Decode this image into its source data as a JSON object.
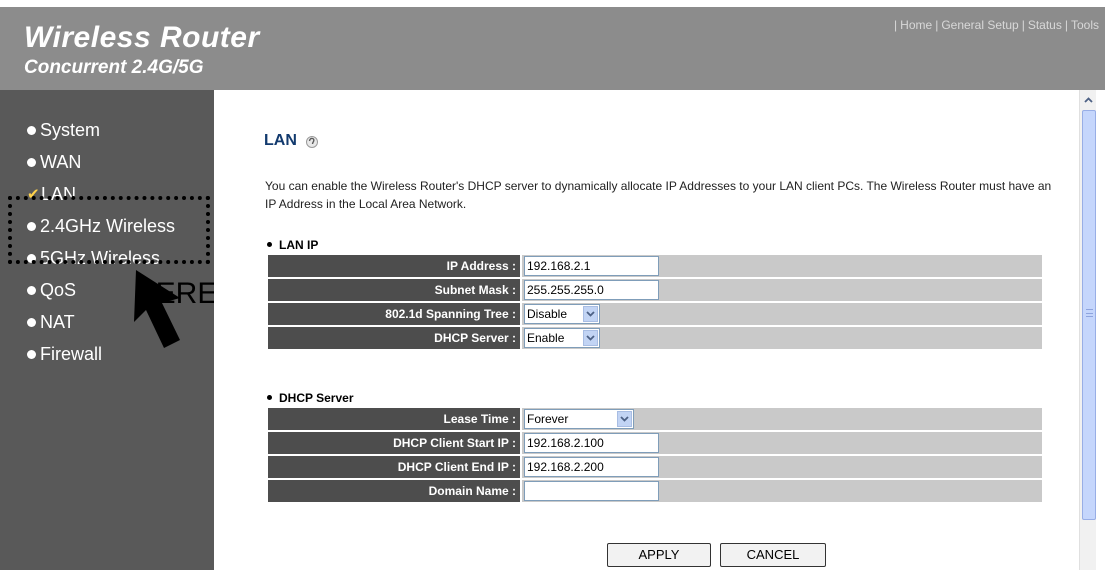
{
  "header": {
    "title": "Wireless Router",
    "subtitle": "Concurrent 2.4G/5G",
    "nav": [
      "Home",
      "General Setup",
      "Status",
      "Tools"
    ]
  },
  "sidebar": {
    "items": [
      {
        "label": "System",
        "marker": "bullet"
      },
      {
        "label": "WAN",
        "marker": "bullet"
      },
      {
        "label": "LAN",
        "marker": "check",
        "selected": true
      },
      {
        "label": "2.4GHz Wireless",
        "marker": "bullet"
      },
      {
        "label": "5GHz Wireless",
        "marker": "bullet"
      },
      {
        "label": "QoS",
        "marker": "bullet"
      },
      {
        "label": "NAT",
        "marker": "bullet"
      },
      {
        "label": "Firewall",
        "marker": "bullet"
      }
    ]
  },
  "annotation": {
    "label": "HERE!",
    "icon": "arrow-pointer-icon"
  },
  "main": {
    "title": "LAN",
    "title_icon": "help-icon",
    "description": "You can enable the Wireless Router's DHCP server to dynamically allocate IP Addresses to your LAN client PCs. The Wireless Router must have an IP Address in the Local Area Network.",
    "lan_ip": {
      "heading": "LAN IP",
      "ip_address": {
        "label": "IP Address :",
        "value": "192.168.2.1"
      },
      "subnet_mask": {
        "label": "Subnet Mask :",
        "value": "255.255.255.0"
      },
      "spanning_tree": {
        "label": "802.1d Spanning Tree :",
        "value": "Disable"
      },
      "dhcp_server": {
        "label": "DHCP Server :",
        "value": "Enable"
      }
    },
    "dhcp": {
      "heading": "DHCP Server",
      "lease_time": {
        "label": "Lease Time :",
        "value": "Forever"
      },
      "start_ip": {
        "label": "DHCP Client Start IP :",
        "value": "192.168.2.100"
      },
      "end_ip": {
        "label": "DHCP Client End IP :",
        "value": "192.168.2.200"
      },
      "domain_name": {
        "label": "Domain Name :",
        "value": ""
      }
    },
    "buttons": {
      "apply": "APPLY",
      "cancel": "CANCEL"
    }
  },
  "colors": {
    "header_bg": "#8c8c8c",
    "sidebar_bg": "#595959",
    "label_bg": "#4d4d4d",
    "value_bg": "#c9c9c9",
    "title_color": "#123a6e"
  }
}
